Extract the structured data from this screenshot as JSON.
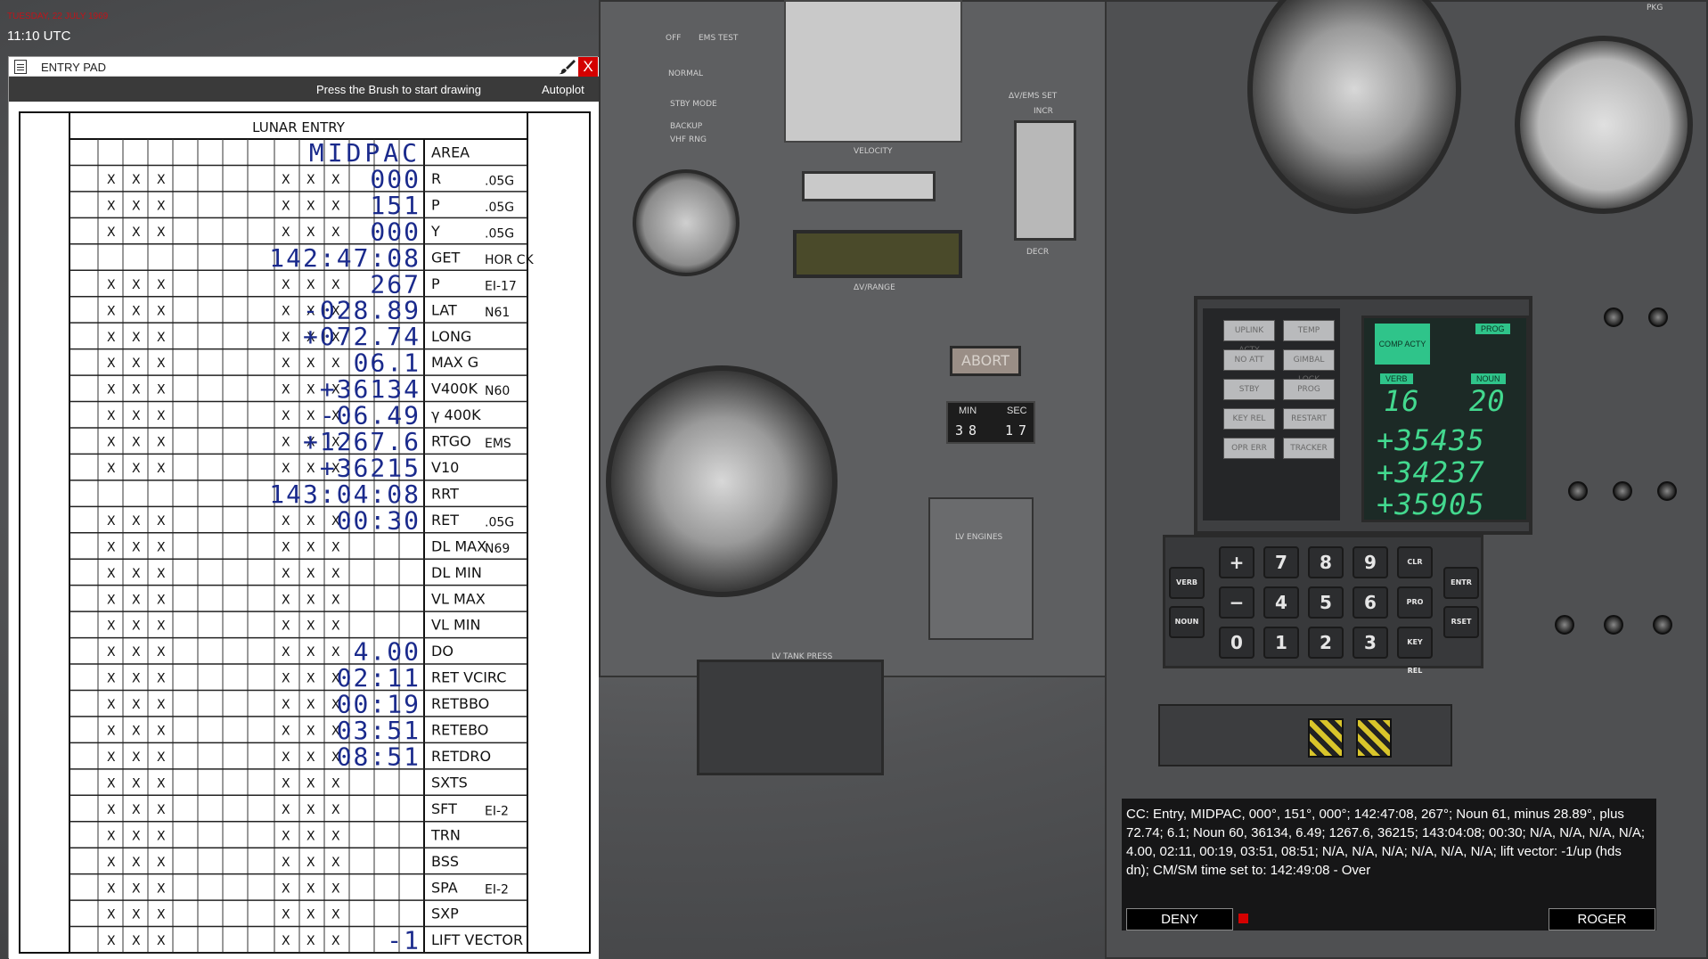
{
  "hud": {
    "date": "TUESDAY, 22 JULY 1969",
    "utc_time": "11:10 UTC"
  },
  "pad_window": {
    "title": "ENTRY PAD",
    "toolbar_hint": "Press the Brush to start drawing",
    "autoplot_label": "Autoplot",
    "close_label": "X",
    "icons": [
      "document-icon",
      "brush-icon",
      "close-icon"
    ]
  },
  "entry_form": {
    "heading": "LUNAR ENTRY",
    "area_value": "MIDPAC",
    "rows": [
      {
        "label": "AREA",
        "sub": "",
        "value": ""
      },
      {
        "label": "R",
        "sub": ".05G",
        "value": "000"
      },
      {
        "label": "P",
        "sub": ".05G",
        "value": "151"
      },
      {
        "label": "Y",
        "sub": ".05G",
        "value": "000"
      },
      {
        "label": "GET",
        "sub": "HOR CK",
        "value": "142:47:08"
      },
      {
        "label": "P",
        "sub": "EI-17",
        "value": "267"
      },
      {
        "label": "LAT",
        "sub": "N61",
        "value": "-028.89"
      },
      {
        "label": "LONG",
        "sub": "",
        "value": "+072.74"
      },
      {
        "label": "MAX G",
        "sub": "",
        "value": "06.1"
      },
      {
        "label": "V400K",
        "sub": "N60",
        "value": "+36134"
      },
      {
        "label": "γ 400K",
        "sub": "",
        "value": "-06.49"
      },
      {
        "label": "RTGO",
        "sub": "EMS",
        "value": "+1267.6"
      },
      {
        "label": "V10",
        "sub": "",
        "value": "+36215"
      },
      {
        "label": "RRT",
        "sub": "",
        "value": "143:04:08"
      },
      {
        "label": "RET",
        "sub": ".05G",
        "value": "00:30"
      },
      {
        "label": "DL MAX",
        "sub": "N69",
        "value": ""
      },
      {
        "label": "DL MIN",
        "sub": "",
        "value": ""
      },
      {
        "label": "VL MAX",
        "sub": "",
        "value": ""
      },
      {
        "label": "VL MIN",
        "sub": "",
        "value": ""
      },
      {
        "label": "DO",
        "sub": "",
        "value": "4.00"
      },
      {
        "label": "RET VCIRC",
        "sub": "",
        "value": "02:11"
      },
      {
        "label": "RETBBO",
        "sub": "",
        "value": "00:19"
      },
      {
        "label": "RETEBO",
        "sub": "",
        "value": "03:51"
      },
      {
        "label": "RETDRO",
        "sub": "",
        "value": "08:51"
      },
      {
        "label": "SXTS",
        "sub": "",
        "value": ""
      },
      {
        "label": "SFT",
        "sub": "EI-2",
        "value": ""
      },
      {
        "label": "TRN",
        "sub": "",
        "value": ""
      },
      {
        "label": "BSS",
        "sub": "",
        "value": ""
      },
      {
        "label": "SPA",
        "sub": "EI-2",
        "value": ""
      },
      {
        "label": "SXP",
        "sub": "",
        "value": ""
      },
      {
        "label": "LIFT VECTOR",
        "sub": "",
        "value": "-1"
      }
    ]
  },
  "dsky": {
    "lamps": [
      "UPLINK ACTY",
      "TEMP",
      "NO ATT",
      "GIMBAL LOCK",
      "STBY",
      "PROG",
      "KEY REL",
      "RESTART",
      "OPR ERR",
      "TRACKER"
    ],
    "comp_acty": "COMP ACTY",
    "prog_label": "PROG",
    "verb_label": "VERB",
    "noun_label": "NOUN",
    "prog": "",
    "verb": "16",
    "noun": "20",
    "r1": "+35435",
    "r2": "+34237",
    "r3": "+35905",
    "keys": [
      "VERB",
      "+",
      "7",
      "8",
      "9",
      "CLR",
      "ENTR",
      "NOUN",
      "−",
      "4",
      "5",
      "6",
      "PRO",
      "RSET",
      "0",
      "1",
      "2",
      "3",
      "KEY REL"
    ]
  },
  "panel_labels": {
    "abort": "ABORT",
    "min": "MIN",
    "sec": "SEC",
    "min_value": "38",
    "sec_value": "17",
    "velocity": "VELOCITY",
    "dv_range": "ΔV/RANGE",
    "dv_ems_set": "ΔV/EMS SET",
    "incr": "INCR",
    "decr": "DECR",
    "lv_engines": "LV ENGINES",
    "lv_tank_press": "LV TANK PRESS",
    "normal": "NORMAL",
    "stby_mode": "STBY MODE",
    "backup": "BACKUP",
    "vhf_rng": "VHF RNG",
    "off": "OFF",
    "ems_test": "EMS TEST",
    "pkg": "PKG"
  },
  "message": {
    "text": "CC: Entry, MIDPAC, 000°, 151°, 000°; 142:47:08, 267°; Noun 61, minus 28.89°, plus 72.74; 6.1; Noun 60, 36134, 6.49; 1267.6, 36215; 143:04:08; 00:30; N/A, N/A, N/A, N/A; 4.00, 02:11, 00:19, 03:51, 08:51; N/A, N/A, N/A; N/A, N/A, N/A; lift vector: -1/up (hds dn); CM/SM time set to: 142:49:08  - Over",
    "deny_label": "DENY",
    "roger_label": "ROGER"
  }
}
